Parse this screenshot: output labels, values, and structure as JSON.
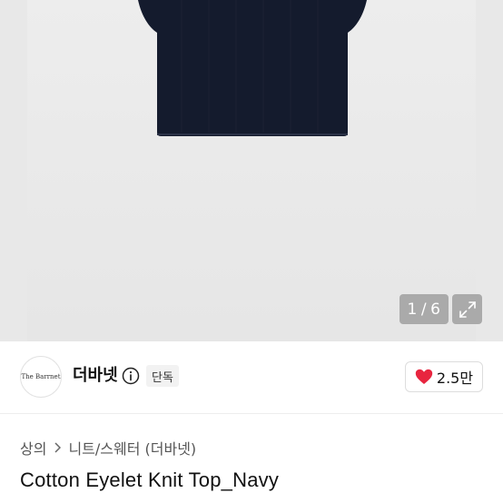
{
  "gallery": {
    "current_image": "1",
    "separator": "/",
    "total_images": "6",
    "colors": {
      "garment": "#141b2d",
      "background": "#e8e8e8"
    }
  },
  "store": {
    "logo_text": "The Barrnet",
    "name": "더바넷",
    "badge": "단독",
    "likes": "2.5만"
  },
  "breadcrumb": {
    "category": "상의",
    "subcategory": "니트/스웨터 (더바넷)"
  },
  "product": {
    "title": "Cotton Eyelet Knit Top_Navy"
  },
  "colors": {
    "heart": "#e8253f"
  }
}
